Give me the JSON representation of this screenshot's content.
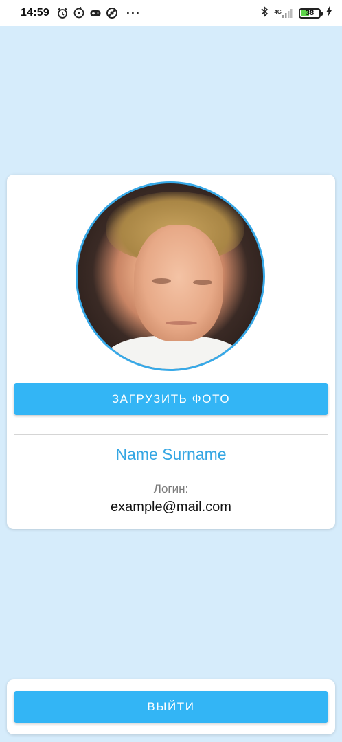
{
  "status_bar": {
    "time": "14:59",
    "more": "···",
    "network": "4G",
    "battery_level": "38",
    "icons": [
      "alarm-icon",
      "sync-icon",
      "game-controller-icon",
      "do-not-disturb-icon",
      "bluetooth-icon",
      "signal-icon",
      "battery-icon",
      "charging-icon"
    ]
  },
  "profile": {
    "upload_label": "ЗАГРУЗИТЬ ФОТО",
    "name": "Name Surname",
    "login_label": "Логин:",
    "login_value": "example@mail.com"
  },
  "logout": {
    "label": "ВЫЙТИ"
  },
  "colors": {
    "background": "#d6ecfb",
    "accent": "#33b5f5",
    "name_text": "#34a6e3"
  }
}
